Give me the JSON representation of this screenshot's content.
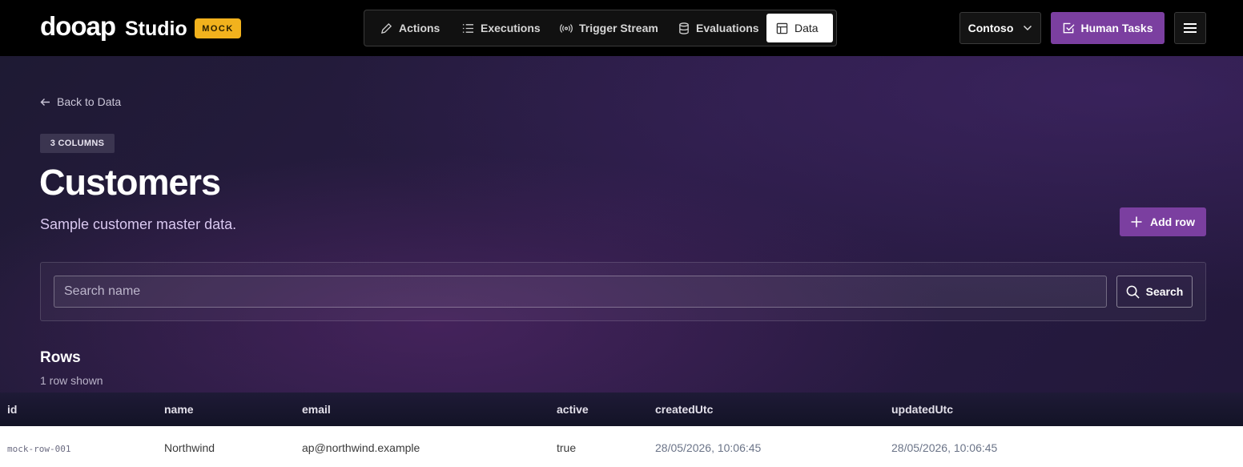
{
  "header": {
    "brand": "dooap",
    "product": "Studio",
    "env_badge": "MOCK",
    "nav": [
      {
        "label": "Actions",
        "icon": "pencil-icon",
        "active": false
      },
      {
        "label": "Executions",
        "icon": "list-icon",
        "active": false
      },
      {
        "label": "Trigger Stream",
        "icon": "broadcast-icon",
        "active": false
      },
      {
        "label": "Evaluations",
        "icon": "database-icon",
        "active": false
      },
      {
        "label": "Data",
        "icon": "table-icon",
        "active": true
      }
    ],
    "tenant": "Contoso",
    "human_tasks": "Human Tasks"
  },
  "page": {
    "back_label": "Back to Data",
    "columns_badge": "3 COLUMNS",
    "title": "Customers",
    "description": "Sample customer master data.",
    "add_row_label": "Add row"
  },
  "search": {
    "placeholder": "Search name",
    "value": "",
    "button_label": "Search"
  },
  "rows_section": {
    "title": "Rows",
    "count_text": "1 row shown"
  },
  "table": {
    "headers": [
      "id",
      "name",
      "email",
      "active",
      "createdUtc",
      "updatedUtc"
    ],
    "rows": [
      [
        "mock-row-001",
        "Northwind",
        "ap@northwind.example",
        "true",
        "28/05/2026, 10:06:45",
        "28/05/2026, 10:06:45"
      ]
    ]
  },
  "colors": {
    "accent": "#7b3fa0",
    "badge": "#f2b21d",
    "topbar": "#000000"
  }
}
